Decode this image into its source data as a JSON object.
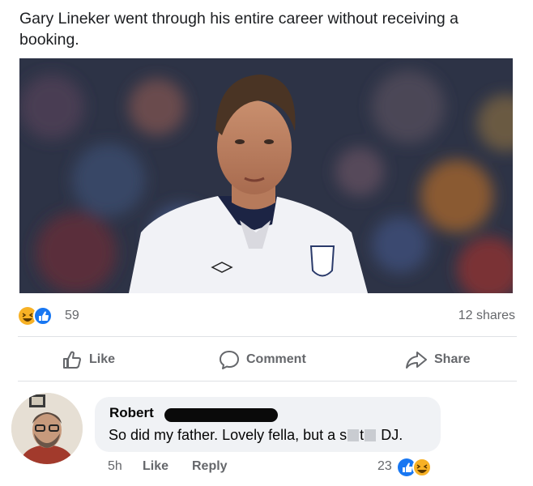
{
  "post": {
    "text": "Gary Lineker went through his entire career without receiving a booking.",
    "reaction_count": "59",
    "shares": "12 shares",
    "reaction_icons": [
      "haha-icon",
      "like-icon"
    ]
  },
  "actions": {
    "like": "Like",
    "comment": "Comment",
    "share": "Share"
  },
  "comment": {
    "author": "Robert",
    "text_before": "So did my father. Lovely fella, but a s",
    "text_mid": "t",
    "text_after": "DJ.",
    "time": "5h",
    "like": "Like",
    "reply": "Reply",
    "reaction_count": "23",
    "reaction_icons": [
      "like-icon",
      "haha-icon"
    ]
  },
  "colors": {
    "fb_blue": "#1877f2",
    "haha_yellow": "#f7b125",
    "secondary_text": "#65676b",
    "bubble_bg": "#f0f2f5"
  }
}
